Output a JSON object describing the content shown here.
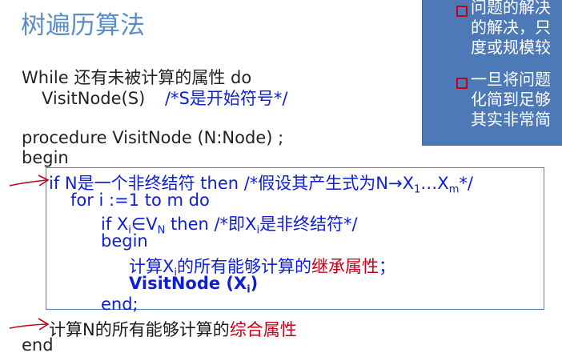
{
  "title": "树遍历算法",
  "while_line": "While  还有未被计算的属性  do",
  "visit_line": {
    "call": "VisitNode(S)",
    "comment": "/*S是开始符号*/"
  },
  "proc_line": "procedure VisitNode (N:Node) ;",
  "begin": "begin",
  "if_line": {
    "text": "if N是一个非终结符 then  /*假设其产生式为N→X",
    "sub1": "1",
    "mid": "…X",
    "sub2": "m",
    "end": "*/"
  },
  "for_line": "for i :=1 to  m  do",
  "if2_line": {
    "a": "if X",
    "a_sub": "i",
    "b": "∈V",
    "b_sub": "N",
    "c": " then /*即X",
    "c_sub": "i",
    "d": "是非终结符*/"
  },
  "inner_begin": "begin",
  "calc_inh": {
    "prefix": "计算X",
    "sub": "i",
    "middle": "的所有能够计算的",
    "red": "继承属性",
    "suffix": "；"
  },
  "visit_xi": {
    "text": "VisitNode (X",
    "sub": "i",
    "end": ")"
  },
  "inner_end": "end;",
  "calc_syn": {
    "prefix": "计算N的所有能够计算的",
    "red": "综合属性"
  },
  "end": "end",
  "panel": {
    "items": [
      [
        "问题的解决",
        "的解决，只",
        "度或规模较"
      ],
      [
        "一旦将问题",
        "化简到足够",
        "其实非常简"
      ]
    ]
  },
  "colors": {
    "title": "#5b8dc3",
    "code_blue": "#0e1fd0",
    "highlight_red": "#c0001a",
    "panel_bg": "#4d79b6",
    "box_border": "#4e81bd"
  }
}
